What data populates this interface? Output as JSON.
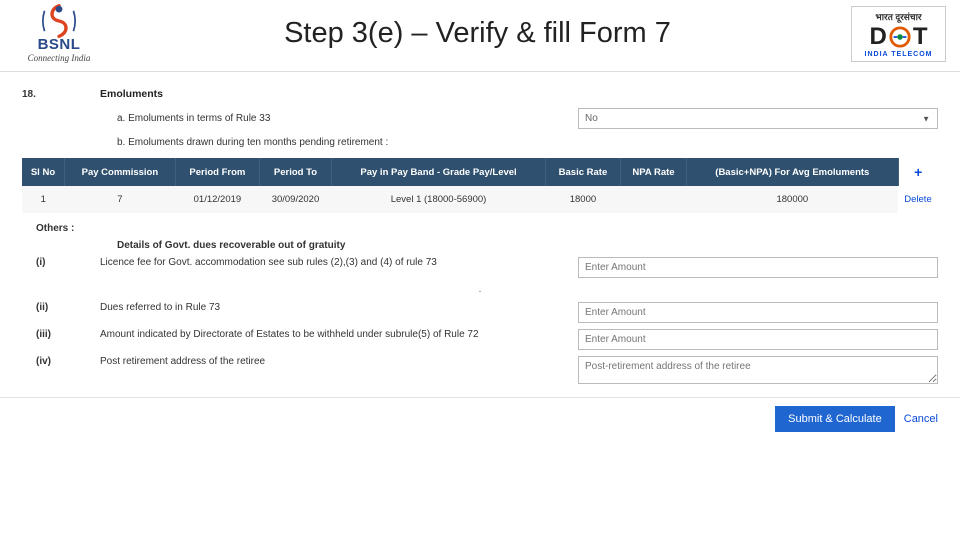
{
  "header": {
    "bsnl": "BSNL",
    "bsnl_tag": "Connecting India",
    "title": "Step 3(e) – Verify & fill Form 7",
    "dot_hindi": "भारत दूरसंचार",
    "dot_d": "D",
    "dot_t": "T",
    "dot_india": "INDIA TELECOM"
  },
  "section": {
    "num": "18.",
    "title": "Emoluments",
    "a_label": "a. Emoluments in terms of Rule 33",
    "a_value": "No",
    "b_label": "b. Emoluments drawn during ten months pending retirement :"
  },
  "table": {
    "headers": [
      "Sl No",
      "Pay Commission",
      "Period From",
      "Period To",
      "Pay in Pay Band - Grade Pay/Level",
      "Basic Rate",
      "NPA Rate",
      "(Basic+NPA) For Avg Emoluments"
    ],
    "plus": "+",
    "rows": [
      {
        "cells": [
          "1",
          "7",
          "01/12/2019",
          "30/09/2020",
          "Level 1 (18000-56900)",
          "18000",
          "",
          "180000"
        ],
        "action": "Delete"
      }
    ]
  },
  "others": "Others :",
  "details_heading": "Details of Govt. dues recoverable out of gratuity",
  "dues": [
    {
      "r": "(i)",
      "label": "Licence fee for Govt. accommodation see sub rules (2),(3) and (4) of rule 73",
      "ph": "Enter Amount",
      "type": "text"
    },
    {
      "r": "(ii)",
      "label": "Dues referred to in Rule 73",
      "ph": "Enter Amount",
      "type": "text"
    },
    {
      "r": "(iii)",
      "label": "Amount indicated by Directorate of Estates to be withheld under subrule(5) of Rule 72",
      "ph": "Enter Amount",
      "type": "text"
    },
    {
      "r": "(iv)",
      "label": "Post retirement address of the retiree",
      "ph": "Post-retirement address of the retiree",
      "type": "textarea"
    }
  ],
  "footer": {
    "submit": "Submit & Calculate",
    "cancel": "Cancel"
  }
}
